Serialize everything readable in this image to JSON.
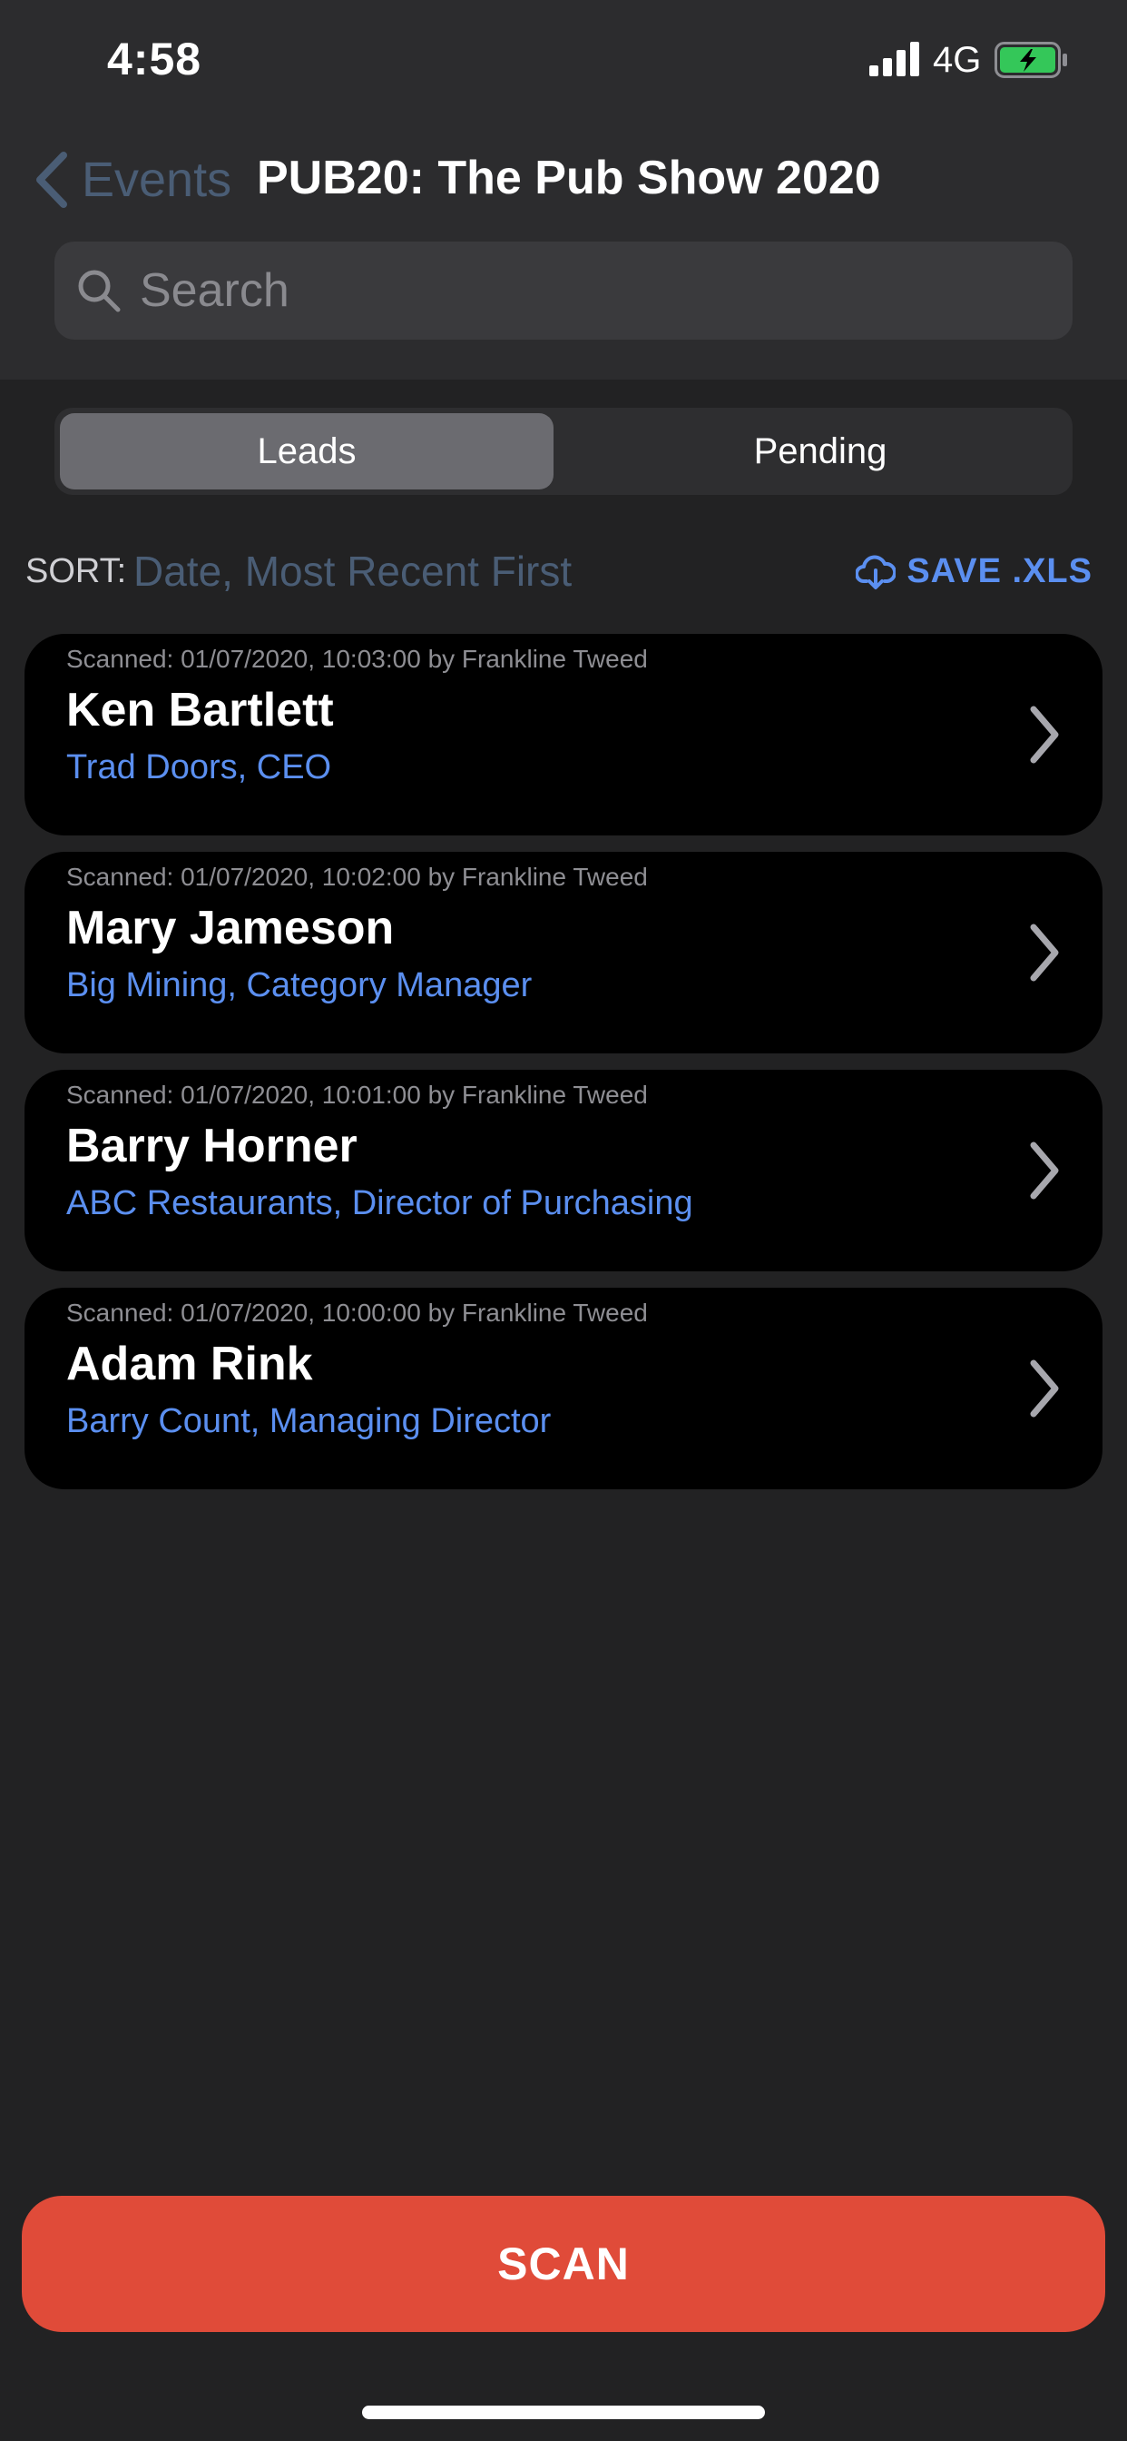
{
  "status_bar": {
    "time": "4:58",
    "network": "4G",
    "signal_icon": "cellular-signal-icon",
    "battery_icon": "battery-charging-icon",
    "battery_color": "#34c759"
  },
  "nav": {
    "back_label": "Events",
    "title": "PUB20: The Pub Show 2020"
  },
  "search": {
    "placeholder": "Search",
    "value": ""
  },
  "tabs": [
    {
      "label": "Leads",
      "selected": true
    },
    {
      "label": "Pending",
      "selected": false
    }
  ],
  "sort": {
    "label": "SORT:",
    "value": "Date, Most Recent First"
  },
  "export": {
    "label": "SAVE .XLS",
    "icon": "cloud-download-icon"
  },
  "leads": [
    {
      "scanned": "Scanned: 01/07/2020, 10:03:00 by Frankline Tweed",
      "name": "Ken Bartlett",
      "company": "Trad Doors, CEO"
    },
    {
      "scanned": "Scanned: 01/07/2020, 10:02:00 by Frankline Tweed",
      "name": "Mary Jameson",
      "company": "Big Mining, Category Manager"
    },
    {
      "scanned": "Scanned: 01/07/2020, 10:01:00 by Frankline Tweed",
      "name": "Barry Horner",
      "company": "ABC Restaurants, Director of Purchasing"
    },
    {
      "scanned": "Scanned: 01/07/2020, 10:00:00 by Frankline Tweed",
      "name": "Adam Rink",
      "company": "Barry Count, Managing Director"
    }
  ],
  "scan_button": {
    "label": "SCAN"
  },
  "colors": {
    "accent": "#5b8ff0",
    "scan_button": "#e04b39",
    "back_link": "#4a5d75",
    "card_background": "#000000"
  }
}
